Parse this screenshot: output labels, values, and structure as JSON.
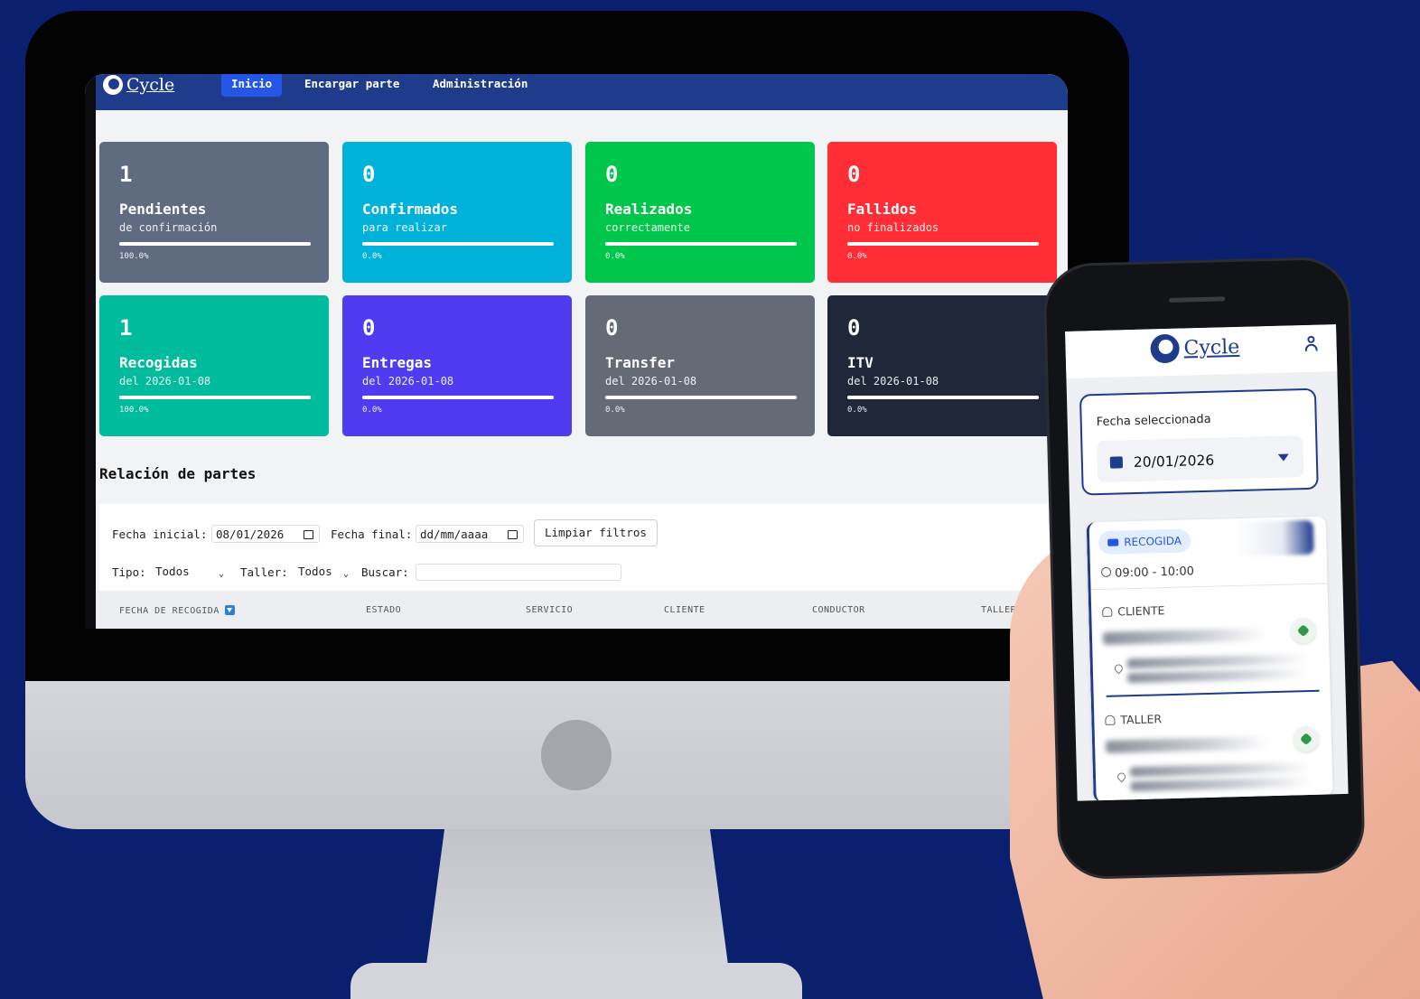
{
  "desktop": {
    "brand": "Cycle",
    "nav": [
      "Inicio",
      "Encargar parte",
      "Administración"
    ],
    "cards": [
      {
        "count": "1",
        "title": "Pendientes",
        "subtitle": "de confirmación",
        "percent": "100.0%",
        "fill": 1.0,
        "color": "#5f6b80"
      },
      {
        "count": "0",
        "title": "Confirmados",
        "subtitle": "para realizar",
        "percent": "0.0%",
        "fill": 1.0,
        "color": "#00b2d9"
      },
      {
        "count": "0",
        "title": "Realizados",
        "subtitle": "correctamente",
        "percent": "0.0%",
        "fill": 1.0,
        "color": "#00c64c"
      },
      {
        "count": "0",
        "title": "Fallidos",
        "subtitle": "no finalizados",
        "percent": "0.0%",
        "fill": 1.0,
        "color": "#ff2d36"
      },
      {
        "count": "1",
        "title": "Recogidas",
        "subtitle": "del 2026-01-08",
        "percent": "100.0%",
        "fill": 1.0,
        "color": "#00bb9c"
      },
      {
        "count": "0",
        "title": "Entregas",
        "subtitle": "del 2026-01-08",
        "percent": "0.0%",
        "fill": 1.0,
        "color": "#4f3cf0"
      },
      {
        "count": "0",
        "title": "Transfer",
        "subtitle": "del 2026-01-08",
        "percent": "0.0%",
        "fill": 1.0,
        "color": "#646b76"
      },
      {
        "count": "0",
        "title": "ITV",
        "subtitle": "del 2026-01-08",
        "percent": "0.0%",
        "fill": 1.0,
        "color": "#1e2838"
      }
    ],
    "section_title": "Relación de partes",
    "filters": {
      "start_label": "Fecha inicial:",
      "start_value": "08/01/2026",
      "end_label": "Fecha final:",
      "end_placeholder": "dd/mm/aaaa",
      "clear_button": "Limpiar filtros",
      "type_label": "Tipo:",
      "type_value": "Todos",
      "workshop_label": "Taller:",
      "workshop_value": "Todos",
      "search_label": "Buscar:"
    },
    "table_headers": [
      "FECHA DE RECOGIDA",
      "ESTADO",
      "SERVICIO",
      "CLIENTE",
      "CONDUCTOR",
      "TALLER"
    ]
  },
  "mobile": {
    "brand": "Cycle",
    "date_label": "Fecha seleccionada",
    "date_value": "20/01/2026",
    "badge": "RECOGIDA",
    "time": "09:00 - 10:00",
    "client_label": "CLIENTE",
    "workshop_label": "TALLER"
  },
  "colors": {
    "background": "#0a1f6e",
    "nav": "#1f3b8c",
    "accent": "#2456e8"
  }
}
